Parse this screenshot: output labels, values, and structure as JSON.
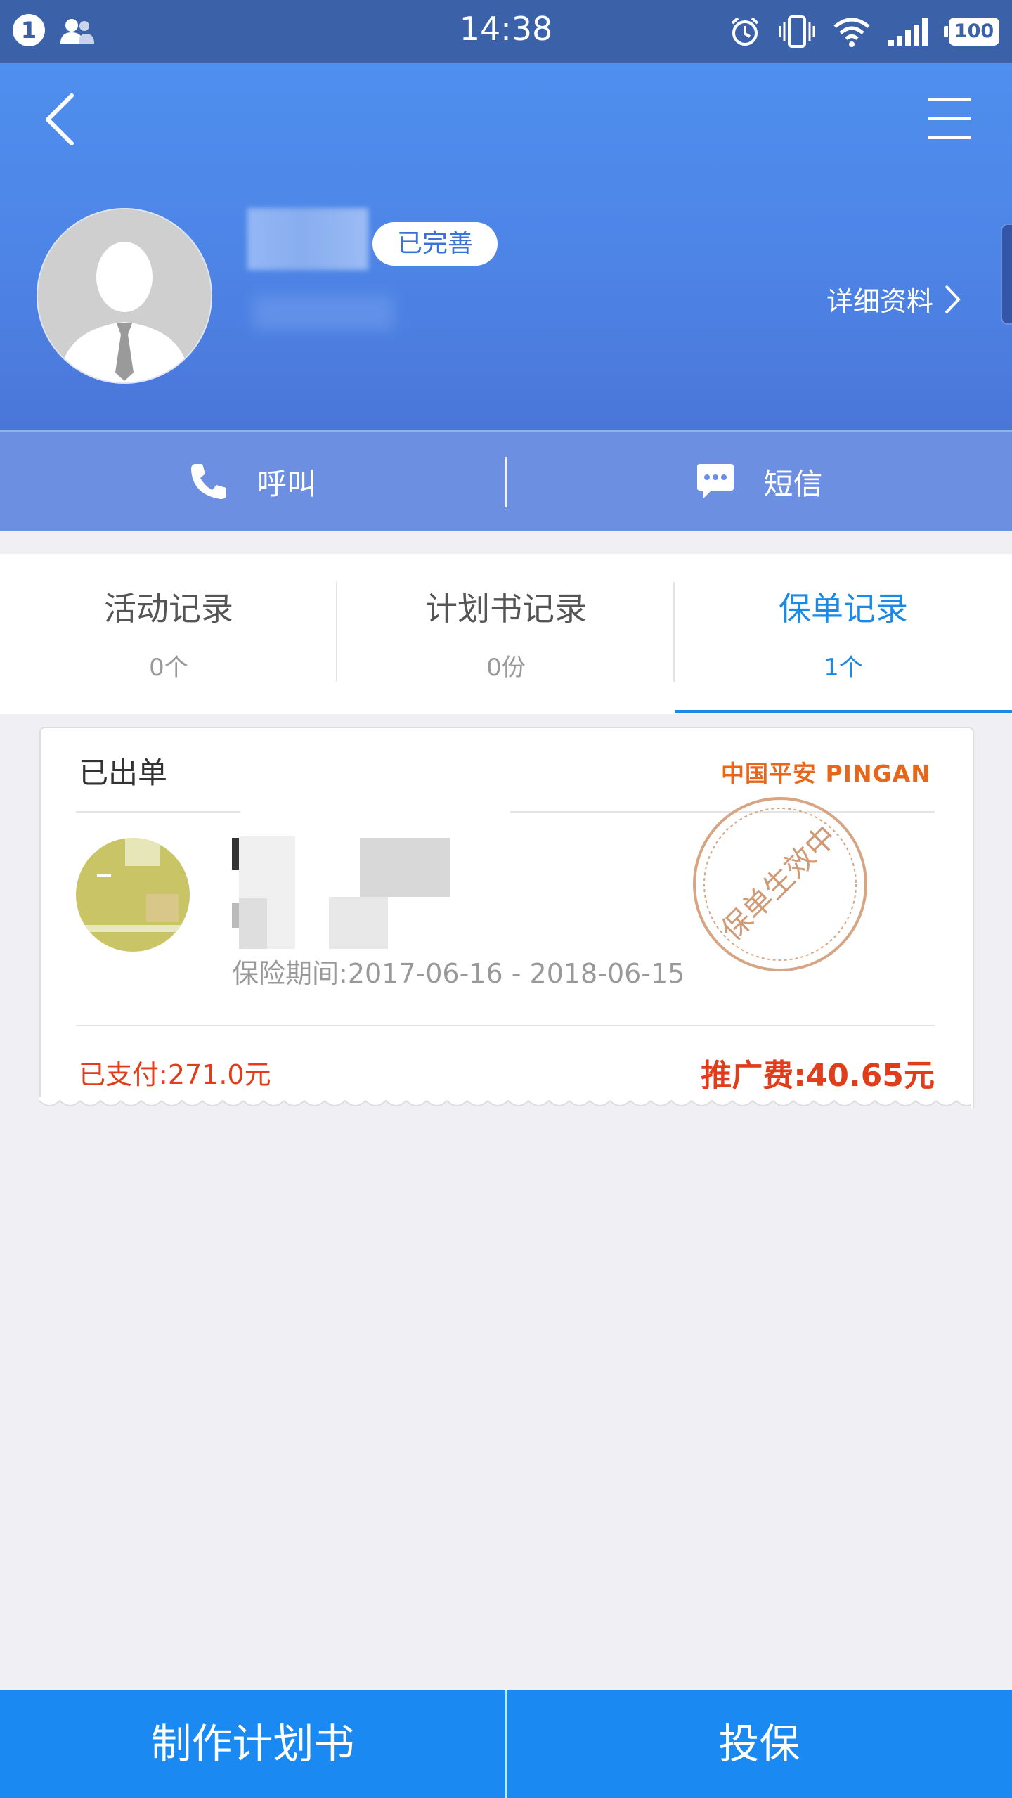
{
  "status_bar": {
    "notification_count": "1",
    "time": "14:38",
    "battery": "100",
    "icons": [
      "people-icon",
      "alarm-icon",
      "vibrate-icon",
      "wifi-icon",
      "signal-icon",
      "battery-icon"
    ]
  },
  "header": {
    "back_icon": "chevron-left-icon",
    "menu_icon": "hamburger-menu-icon",
    "profile_badge": "已完善",
    "detail_link": "详细资料",
    "colors": {
      "gradient_top": "#4f8fee",
      "gradient_bottom": "#4a76d8"
    }
  },
  "actions": {
    "call_label": "呼叫",
    "sms_label": "短信"
  },
  "tabs": [
    {
      "label": "活动记录",
      "count": "0个",
      "active": false
    },
    {
      "label": "计划书记录",
      "count": "0份",
      "active": false
    },
    {
      "label": "保单记录",
      "count": "1个",
      "active": true
    }
  ],
  "policy_card": {
    "status": "已出单",
    "brand_logo": "中国平安 PINGAN",
    "stamp_text": "保单生效中",
    "period_label": "保险期间:",
    "period_value": "2017-06-16 - 2018-06-15",
    "paid_label": "已支付:",
    "paid_value": "271.0元",
    "fee_label": "推广费:",
    "fee_value": "40.65元",
    "accent_color": "#e23d1a"
  },
  "bottom_bar": {
    "make_plan_label": "制作计划书",
    "insure_label": "投保",
    "color": "#1a8af2"
  }
}
